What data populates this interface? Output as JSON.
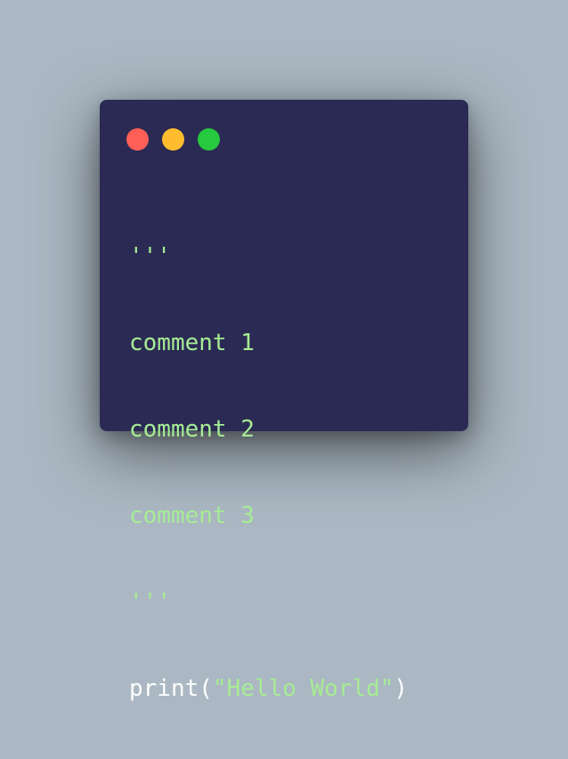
{
  "window": {
    "controls": {
      "close_color": "#ff5f56",
      "minimize_color": "#ffbd2e",
      "maximize_color": "#27c93f"
    },
    "code_lines": [
      "'''",
      "comment 1",
      "comment 2",
      "comment 3",
      "'''"
    ],
    "print_line": {
      "func": "print(",
      "string": "\"Hello World\"",
      "close": ")"
    }
  },
  "colors": {
    "background": "#abb8c3",
    "window": "#2b2a54",
    "string": "#a6ec94",
    "text": "#ffffff"
  }
}
